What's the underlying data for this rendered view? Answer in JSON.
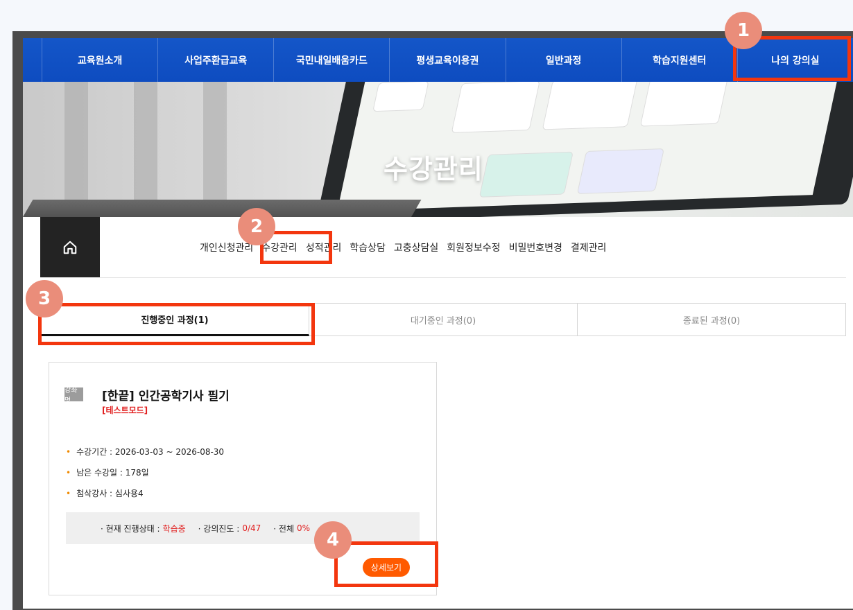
{
  "nav": {
    "items": [
      "교육원소개",
      "사업주환급교육",
      "국민내일배움카드",
      "평생교육이용권",
      "일반과정",
      "학습지원센터",
      "나의 강의실"
    ]
  },
  "banner": {
    "title": "수강관리"
  },
  "subnav": {
    "items": [
      "개인신청관리",
      "수강관리",
      "성적관리",
      "학습상담",
      "고충상담실",
      "회원정보수정",
      "비밀번호변경",
      "결제관리"
    ]
  },
  "tabs": [
    "진행중인 과정(1)",
    "대기중인 과정(0)",
    "종료된 과정(0)"
  ],
  "course": {
    "badge": "강좌명",
    "title": "[한끝] 인간공학기사 필기",
    "tag": "[테스트모드]",
    "period": "수강기간 : 2026-03-03 ~ 2026-08-30",
    "remaining": "남은 수강일 : 178일",
    "tutor": "첨삭강사 : 심사용4",
    "status_label": "· 현재 진행상태 :",
    "status_value": "학습중",
    "progress_label": "· 강의진도 :",
    "progress_value": "0/47",
    "overall_label": "· 전체",
    "overall_value": "0%",
    "detail_button": "상세보기"
  },
  "annotations": [
    "1",
    "2",
    "3",
    "4"
  ],
  "colors": {
    "nav_blue": "#1456c8",
    "highlight": "#f3360e",
    "accent_orange": "#ff5a00"
  }
}
